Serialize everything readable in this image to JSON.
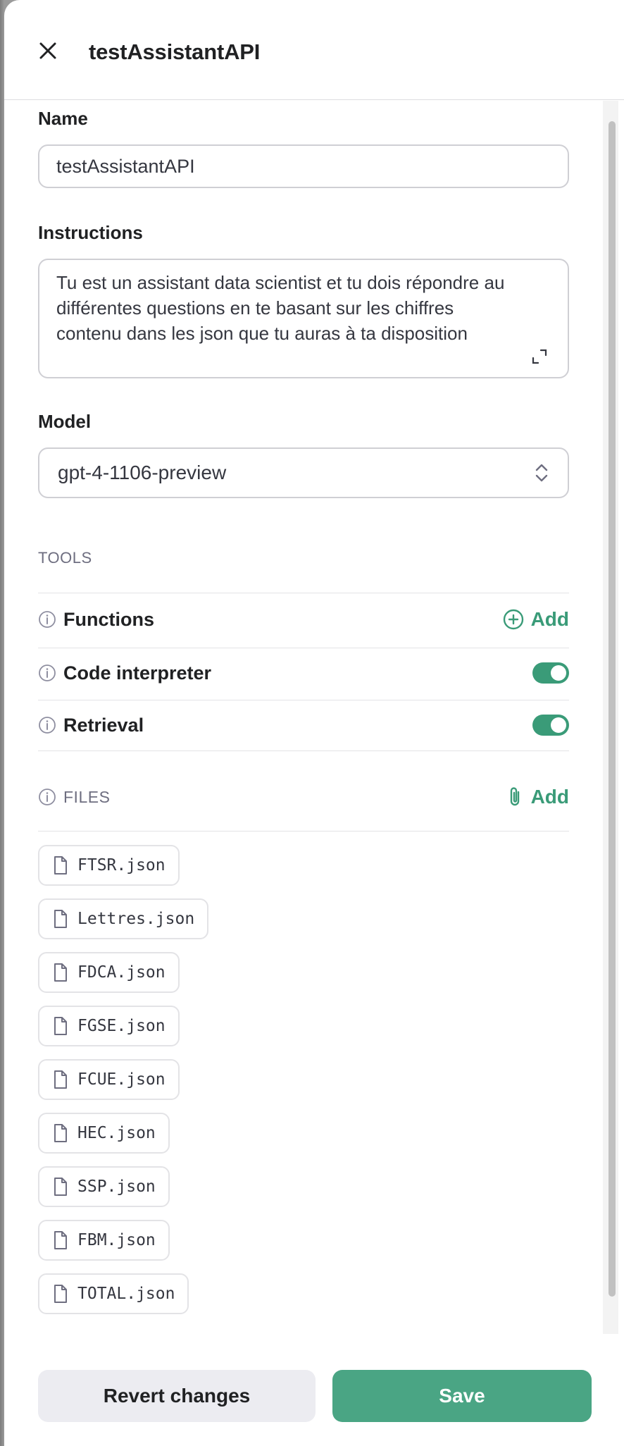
{
  "header": {
    "title": "testAssistantAPI"
  },
  "form": {
    "name_label": "Name",
    "name_value": "testAssistantAPI",
    "instructions_label": "Instructions",
    "instructions_line1": "Tu est un assistant data scientist et tu dois répondre au",
    "instructions_line2": "différentes questions en te basant sur les chiffres",
    "instructions_line3": "contenu dans les json que tu auras à ta disposition",
    "model_label": "Model",
    "model_value": "gpt-4-1106-preview"
  },
  "tools": {
    "caption": "TOOLS",
    "items": [
      {
        "label": "Functions",
        "action": "Add"
      },
      {
        "label": "Code interpreter",
        "enabled": true
      },
      {
        "label": "Retrieval",
        "enabled": true
      }
    ]
  },
  "files": {
    "caption": "FILES",
    "add_label": "Add",
    "items": [
      "FTSR.json",
      "Lettres.json",
      "FDCA.json",
      "FGSE.json",
      "FCUE.json",
      "HEC.json",
      "SSP.json",
      "FBM.json",
      "TOTAL.json"
    ]
  },
  "footer": {
    "revert_label": "Revert changes",
    "save_label": "Save"
  },
  "colors": {
    "accent": "#3a9b78",
    "save_button": "#4aa584",
    "revert_button": "#ececf1"
  },
  "icons": [
    "close-icon",
    "expand-icon",
    "chevron-updown-icon",
    "info-icon",
    "plus-circle-icon",
    "paperclip-icon",
    "file-icon"
  ]
}
